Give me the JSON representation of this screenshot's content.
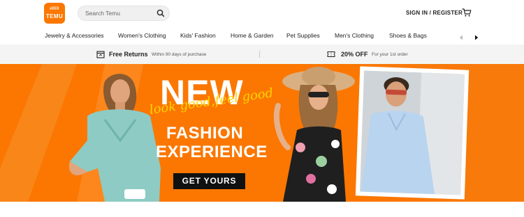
{
  "header": {
    "logo_glyph": "ᵃᴮᴱᴮ",
    "logo_text": "TEMU",
    "search_placeholder": "Search Temu",
    "signin_label": "SIGN IN / REGISTER"
  },
  "nav": {
    "items": [
      {
        "label": "Jewelry & Accessories"
      },
      {
        "label": "Women's Clothing"
      },
      {
        "label": "Kids' Fashion"
      },
      {
        "label": "Home & Garden"
      },
      {
        "label": "Pet Supplies"
      },
      {
        "label": "Men's Clothing"
      },
      {
        "label": "Shoes & Bags"
      }
    ]
  },
  "benefits": [
    {
      "title": "Free Returns",
      "subtitle": "Within 90 days of purchase"
    },
    {
      "title": "20% OFF",
      "subtitle": "For your 1st order"
    }
  ],
  "hero": {
    "headline": "NEW",
    "script": "look good,feel good",
    "line1": "FASHION",
    "line2": "EXPERIENCE",
    "cta": "GET YOURS"
  },
  "colors": {
    "brand": "#fb7701",
    "benefits_bg": "#f4f4f4",
    "script_yellow": "#ffd400",
    "cta_bg": "#111111"
  }
}
